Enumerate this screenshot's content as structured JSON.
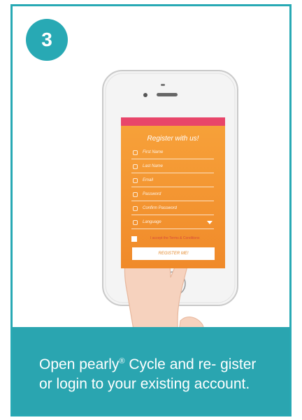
{
  "step": {
    "number": "3"
  },
  "screen": {
    "form_title": "Register with us!",
    "fields": [
      {
        "label": "First Name",
        "icon": "user-icon"
      },
      {
        "label": "Last Name",
        "icon": "user-icon"
      },
      {
        "label": "Email",
        "icon": "mail-icon"
      },
      {
        "label": "Password",
        "icon": "lock-icon"
      },
      {
        "label": "Confirm Password",
        "icon": "lock-icon"
      },
      {
        "label": "Language",
        "icon": "globe-icon"
      }
    ],
    "terms": "I accept the Terms & Conditions",
    "register_label": "REGISTER ME!"
  },
  "caption": {
    "part1": "Open pearly",
    "reg": "®",
    "part2": " Cycle and re- gister or login to your existing account."
  },
  "colors": {
    "accent": "#28a9b4",
    "screen_orange": "#f39233",
    "status_pink": "#e8456a"
  }
}
